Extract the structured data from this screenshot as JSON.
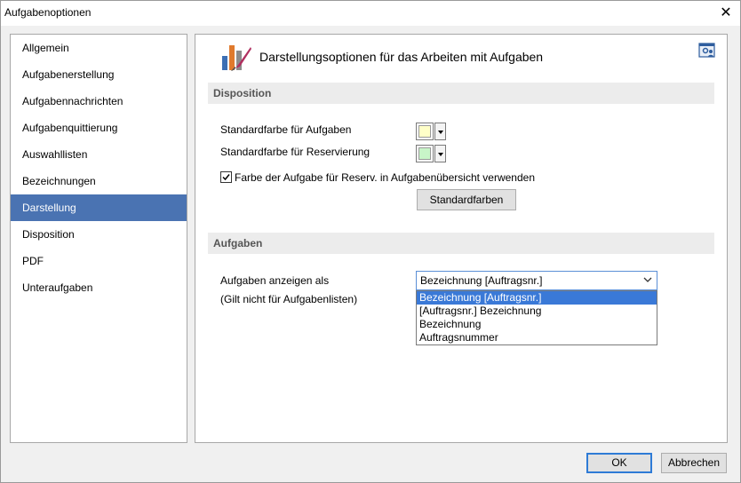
{
  "window": {
    "title": "Aufgabenoptionen",
    "close_glyph": "✕"
  },
  "sidebar": {
    "items": [
      {
        "label": "Allgemein"
      },
      {
        "label": "Aufgabenerstellung"
      },
      {
        "label": "Aufgabennachrichten"
      },
      {
        "label": "Aufgabenquittierung"
      },
      {
        "label": "Auswahllisten"
      },
      {
        "label": "Bezeichnungen"
      },
      {
        "label": "Darstellung",
        "selected": true
      },
      {
        "label": "Disposition"
      },
      {
        "label": "PDF"
      },
      {
        "label": "Unteraufgaben"
      }
    ]
  },
  "content": {
    "header_icon": "color-palette-icon",
    "header_title": "Darstellungsoptionen für das Arbeiten mit Aufgaben",
    "settings_icon": "user-settings-icon",
    "disposition": {
      "title": "Disposition",
      "task_color_label": "Standardfarbe für Aufgaben",
      "task_color": "#ffffc8",
      "reservation_color_label": "Standardfarbe für Reservierung",
      "reservation_color": "#c8f5c8",
      "use_task_color_label": "Farbe der Aufgabe für Reserv. in Aufgabenübersicht verwenden",
      "use_task_color_checked": true,
      "default_colors_button": "Standardfarben"
    },
    "tasks": {
      "title": "Aufgaben",
      "display_as_label": "Aufgaben anzeigen als",
      "display_note": "(Gilt nicht für Aufgabenlisten)",
      "display_selected": "Bezeichnung [Auftragsnr.]",
      "options": [
        "Bezeichnung [Auftragsnr.]",
        "[Auftragsnr.] Bezeichnung",
        "Bezeichnung",
        "Auftragsnummer"
      ]
    }
  },
  "footer": {
    "ok_label": "OK",
    "cancel_label": "Abbrechen"
  },
  "colors": {
    "accent": "#4a73b2",
    "dropdown_highlight": "#3a79d7"
  }
}
